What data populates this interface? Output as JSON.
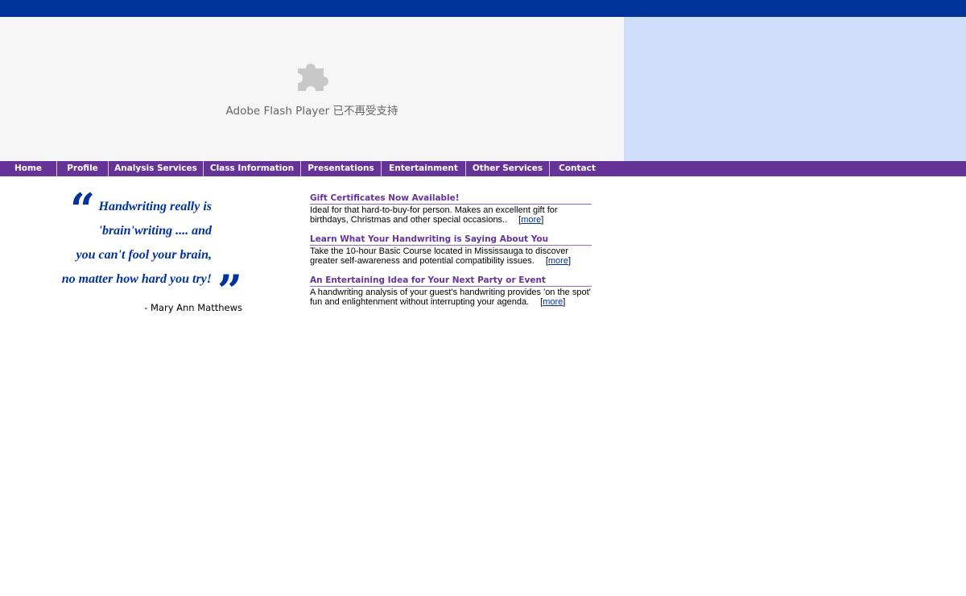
{
  "flash": {
    "message": "Adobe Flash Player 已不再受支持",
    "icon": "puzzle-piece-icon"
  },
  "colors": {
    "top_bar": "#003399",
    "nav_bar": "#663399",
    "side_panel": "#cfdefb",
    "quote_text": "#003399",
    "news_title": "#663399"
  },
  "nav": {
    "items": [
      {
        "label": "Home"
      },
      {
        "label": "Profile"
      },
      {
        "label": "Analysis Services"
      },
      {
        "label": "Class Information"
      },
      {
        "label": "Presentations"
      },
      {
        "label": "Entertainment"
      },
      {
        "label": "Other Services"
      },
      {
        "label": "Contact"
      }
    ]
  },
  "quote": {
    "open_mark": "“",
    "close_mark": "”",
    "lines": [
      "Handwriting really is",
      "'brain'writing .... and",
      "you can't fool your brain,",
      "no matter how hard you try!"
    ],
    "author": "- Mary Ann Matthews"
  },
  "news": [
    {
      "title": "Gift Certificates Now Available!",
      "lines": [
        "Ideal for that hard-to-buy-for person. Makes an excellent gift for",
        "birthdays, Christmas and other special occasions.."
      ],
      "more": "more"
    },
    {
      "title": "Learn What Your Handwriting is Saying About You",
      "lines": [
        "Take the 10-hour Basic Course located in Mississauga to discover",
        "greater self-awareness and potential compatibility issues."
      ],
      "more": "more"
    },
    {
      "title": "An Entertaining Idea for Your Next Party or Event",
      "lines": [
        "A handwriting analysis of your guest's handwriting provides 'on the spot'",
        "fun and enlightenment without interrupting your agenda."
      ],
      "more": "more"
    }
  ]
}
